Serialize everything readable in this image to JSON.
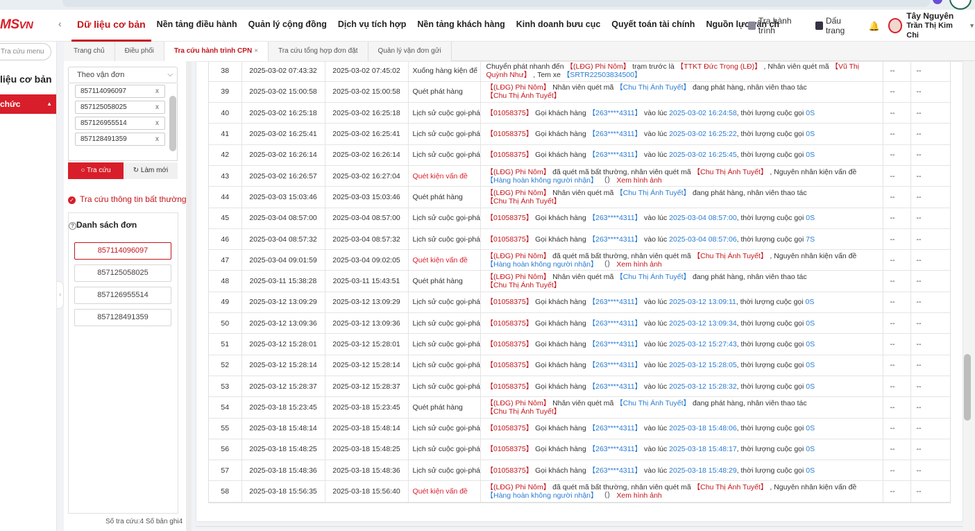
{
  "logo": {
    "main": "MS",
    "suffix": "VN"
  },
  "header": {
    "nav": [
      "Dữ liệu cơ bản",
      "Nền tảng điều hành",
      "Quản lý cộng đồng",
      "Dịch vụ tích hợp",
      "Nền tảng khách hàng",
      "Kinh doanh bưu cục",
      "Quyết toán tài chính",
      "Nguồn lực vận ch"
    ],
    "track_label": "Tra hành trình",
    "bookmark_label": "Dấu trang",
    "user_region": "Tây Nguyên",
    "user_name": "Trần Thị Kim Chi"
  },
  "leftnav": {
    "search_placeholder": "Tra cứu menu",
    "title": "liệu cơ bản",
    "active_item": "chức"
  },
  "tabs": [
    "Trang chủ",
    "Điều phối",
    "Tra cứu hành trình CPN",
    "Tra cứu tổng hợp đơn đặt",
    "Quản lý vận đơn gửi"
  ],
  "active_tab_close": "×",
  "search": {
    "select_value": "Theo vận đơn",
    "tags": [
      "857114096097",
      "857125058025",
      "857126955514",
      "857128491359"
    ],
    "search_btn": "Tra cứu",
    "reset_btn": "Làm mới",
    "abnormal_label": "Tra cứu thông tin bất thường",
    "list_title": "Danh sách đơn",
    "orders": [
      "857114096097",
      "857125058025",
      "857126955514",
      "857128491359"
    ],
    "footer": "Số tra cứu:4  Số bản ghi4"
  },
  "rows": [
    {
      "no": "38",
      "t1": "2025-03-02 07:43:32",
      "t2": "2025-03-02 07:45:02",
      "act": "Xuống hàng kiện đế",
      "warn": false,
      "desc": [
        [
          "n",
          "Chuyển phát nhanh đến "
        ],
        [
          "r",
          "【(LĐG) Phi Nôm】"
        ],
        [
          "n",
          " trạm trước là "
        ],
        [
          "r",
          "【TTKT Đức Trọng (LĐ)】"
        ],
        [
          "n",
          " , Nhân viên quét mã "
        ],
        [
          "r",
          "【Vũ Thị Quỳnh Như】"
        ],
        [
          "n",
          " ,  Tem xe "
        ],
        [
          "b",
          "【SRTR22503834500】"
        ]
      ]
    },
    {
      "no": "39",
      "t1": "2025-03-02 15:00:58",
      "t2": "2025-03-02 15:00:58",
      "act": "Quét phát hàng",
      "warn": false,
      "desc": [
        [
          "r",
          "【(LĐG) Phi Nôm】"
        ],
        [
          "n",
          " Nhân viên quét mã "
        ],
        [
          "b",
          "【Chu Thị Ánh Tuyết】"
        ],
        [
          "n",
          " đang phát hàng, nhân viên thao tác "
        ],
        [
          "r",
          "【Chu Thị Ánh Tuyết】"
        ]
      ]
    },
    {
      "no": "40",
      "t1": "2025-03-02 16:25:18",
      "t2": "2025-03-02 16:25:18",
      "act": "Lịch sử cuộc gọi-phá",
      "warn": false,
      "desc": [
        [
          "r",
          "【01058375】"
        ],
        [
          "n",
          " Gọi khách hàng "
        ],
        [
          "b",
          "【263****4311】"
        ],
        [
          "n",
          " vào lúc "
        ],
        [
          "b",
          "2025-03-02 16:24:58"
        ],
        [
          "n",
          ", thời lượng cuộc gọi "
        ],
        [
          "b",
          "0S"
        ]
      ]
    },
    {
      "no": "41",
      "t1": "2025-03-02 16:25:41",
      "t2": "2025-03-02 16:25:41",
      "act": "Lịch sử cuộc gọi-phá",
      "warn": false,
      "desc": [
        [
          "r",
          "【01058375】"
        ],
        [
          "n",
          " Gọi khách hàng "
        ],
        [
          "b",
          "【263****4311】"
        ],
        [
          "n",
          " vào lúc "
        ],
        [
          "b",
          "2025-03-02 16:25:22"
        ],
        [
          "n",
          ", thời lượng cuộc gọi "
        ],
        [
          "b",
          "0S"
        ]
      ]
    },
    {
      "no": "42",
      "t1": "2025-03-02 16:26:14",
      "t2": "2025-03-02 16:26:14",
      "act": "Lịch sử cuộc gọi-phá",
      "warn": false,
      "desc": [
        [
          "r",
          "【01058375】"
        ],
        [
          "n",
          " Gọi khách hàng "
        ],
        [
          "b",
          "【263****4311】"
        ],
        [
          "n",
          " vào lúc "
        ],
        [
          "b",
          "2025-03-02 16:25:45"
        ],
        [
          "n",
          ", thời lượng cuộc gọi "
        ],
        [
          "b",
          "0S"
        ]
      ]
    },
    {
      "no": "43",
      "t1": "2025-03-02 16:26:57",
      "t2": "2025-03-02 16:27:04",
      "act": "Quét kiện vấn đề",
      "warn": true,
      "desc": [
        [
          "r",
          "【(LĐG) Phi Nôm】"
        ],
        [
          "n",
          " đã quét mã bất thường, nhân viên quét mã "
        ],
        [
          "r",
          "【Chu Thị Ánh Tuyết】"
        ],
        [
          "n",
          " ,  Nguyên nhân kiện vấn đề "
        ],
        [
          "b",
          "【Hàng hoàn không người nhận】"
        ],
        [
          "n",
          " （） "
        ],
        [
          "r",
          "Xem hình ảnh"
        ]
      ]
    },
    {
      "no": "44",
      "t1": "2025-03-03 15:03:46",
      "t2": "2025-03-03 15:03:46",
      "act": "Quét phát hàng",
      "warn": false,
      "desc": [
        [
          "r",
          "【(LĐG) Phi Nôm】"
        ],
        [
          "n",
          " Nhân viên quét mã "
        ],
        [
          "b",
          "【Chu Thị Ánh Tuyết】"
        ],
        [
          "n",
          " đang phát hàng, nhân viên thao tác "
        ],
        [
          "r",
          "【Chu Thị Ánh Tuyết】"
        ]
      ]
    },
    {
      "no": "45",
      "t1": "2025-03-04 08:57:00",
      "t2": "2025-03-04 08:57:00",
      "act": "Lịch sử cuộc gọi-phá",
      "warn": false,
      "desc": [
        [
          "r",
          "【01058375】"
        ],
        [
          "n",
          " Gọi khách hàng "
        ],
        [
          "b",
          "【263****4311】"
        ],
        [
          "n",
          " vào lúc "
        ],
        [
          "b",
          "2025-03-04 08:57:00"
        ],
        [
          "n",
          ", thời lượng cuộc gọi "
        ],
        [
          "b",
          "0S"
        ]
      ]
    },
    {
      "no": "46",
      "t1": "2025-03-04 08:57:32",
      "t2": "2025-03-04 08:57:32",
      "act": "Lịch sử cuộc gọi-phá",
      "warn": false,
      "desc": [
        [
          "r",
          "【01058375】"
        ],
        [
          "n",
          " Gọi khách hàng "
        ],
        [
          "b",
          "【263****4311】"
        ],
        [
          "n",
          " vào lúc "
        ],
        [
          "b",
          "2025-03-04 08:57:06"
        ],
        [
          "n",
          ", thời lượng cuộc gọi "
        ],
        [
          "b",
          "7S"
        ]
      ]
    },
    {
      "no": "47",
      "t1": "2025-03-04 09:01:59",
      "t2": "2025-03-04 09:02:05",
      "act": "Quét kiện vấn đề",
      "warn": true,
      "desc": [
        [
          "r",
          "【(LĐG) Phi Nôm】"
        ],
        [
          "n",
          " đã quét mã bất thường, nhân viên quét mã "
        ],
        [
          "r",
          "【Chu Thị Ánh Tuyết】"
        ],
        [
          "n",
          " ,  Nguyên nhân kiện vấn đề "
        ],
        [
          "b",
          "【Hàng hoàn không người nhận】"
        ],
        [
          "n",
          " （） "
        ],
        [
          "r",
          "Xem hình ảnh"
        ]
      ]
    },
    {
      "no": "48",
      "t1": "2025-03-11 15:38:28",
      "t2": "2025-03-11 15:43:51",
      "act": "Quét phát hàng",
      "warn": false,
      "desc": [
        [
          "r",
          "【(LĐG) Phi Nôm】"
        ],
        [
          "n",
          " Nhân viên quét mã "
        ],
        [
          "b",
          "【Chu Thị Ánh Tuyết】"
        ],
        [
          "n",
          " đang phát hàng, nhân viên thao tác "
        ],
        [
          "r",
          "【Chu Thị Ánh Tuyết】"
        ]
      ]
    },
    {
      "no": "49",
      "t1": "2025-03-12 13:09:29",
      "t2": "2025-03-12 13:09:29",
      "act": "Lịch sử cuộc gọi-phá",
      "warn": false,
      "desc": [
        [
          "r",
          "【01058375】"
        ],
        [
          "n",
          " Gọi khách hàng "
        ],
        [
          "b",
          "【263****4311】"
        ],
        [
          "n",
          " vào lúc "
        ],
        [
          "b",
          "2025-03-12 13:09:11"
        ],
        [
          "n",
          ", thời lượng cuộc gọi "
        ],
        [
          "b",
          "0S"
        ]
      ]
    },
    {
      "no": "50",
      "t1": "2025-03-12 13:09:36",
      "t2": "2025-03-12 13:09:36",
      "act": "Lịch sử cuộc gọi-phá",
      "warn": false,
      "desc": [
        [
          "r",
          "【01058375】"
        ],
        [
          "n",
          " Gọi khách hàng "
        ],
        [
          "b",
          "【263****4311】"
        ],
        [
          "n",
          " vào lúc "
        ],
        [
          "b",
          "2025-03-12 13:09:34"
        ],
        [
          "n",
          ", thời lượng cuộc gọi "
        ],
        [
          "b",
          "0S"
        ]
      ]
    },
    {
      "no": "51",
      "t1": "2025-03-12 15:28:01",
      "t2": "2025-03-12 15:28:01",
      "act": "Lịch sử cuộc gọi-phá",
      "warn": false,
      "desc": [
        [
          "r",
          "【01058375】"
        ],
        [
          "n",
          " Gọi khách hàng "
        ],
        [
          "b",
          "【263****4311】"
        ],
        [
          "n",
          " vào lúc "
        ],
        [
          "b",
          "2025-03-12 15:27:43"
        ],
        [
          "n",
          ", thời lượng cuộc gọi "
        ],
        [
          "b",
          "0S"
        ]
      ]
    },
    {
      "no": "52",
      "t1": "2025-03-12 15:28:14",
      "t2": "2025-03-12 15:28:14",
      "act": "Lịch sử cuộc gọi-phá",
      "warn": false,
      "desc": [
        [
          "r",
          "【01058375】"
        ],
        [
          "n",
          " Gọi khách hàng "
        ],
        [
          "b",
          "【263****4311】"
        ],
        [
          "n",
          " vào lúc "
        ],
        [
          "b",
          "2025-03-12 15:28:05"
        ],
        [
          "n",
          ", thời lượng cuộc gọi "
        ],
        [
          "b",
          "0S"
        ]
      ]
    },
    {
      "no": "53",
      "t1": "2025-03-12 15:28:37",
      "t2": "2025-03-12 15:28:37",
      "act": "Lịch sử cuộc gọi-phá",
      "warn": false,
      "desc": [
        [
          "r",
          "【01058375】"
        ],
        [
          "n",
          " Gọi khách hàng "
        ],
        [
          "b",
          "【263****4311】"
        ],
        [
          "n",
          " vào lúc "
        ],
        [
          "b",
          "2025-03-12 15:28:32"
        ],
        [
          "n",
          ", thời lượng cuộc gọi "
        ],
        [
          "b",
          "0S"
        ]
      ]
    },
    {
      "no": "54",
      "t1": "2025-03-18 15:23:45",
      "t2": "2025-03-18 15:23:45",
      "act": "Quét phát hàng",
      "warn": false,
      "desc": [
        [
          "r",
          "【(LĐG) Phi Nôm】"
        ],
        [
          "n",
          " Nhân viên quét mã "
        ],
        [
          "b",
          "【Chu Thị Ánh Tuyết】"
        ],
        [
          "n",
          " đang phát hàng, nhân viên thao tác "
        ],
        [
          "r",
          "【Chu Thị Ánh Tuyết】"
        ]
      ]
    },
    {
      "no": "55",
      "t1": "2025-03-18 15:48:14",
      "t2": "2025-03-18 15:48:14",
      "act": "Lịch sử cuộc gọi-phá",
      "warn": false,
      "desc": [
        [
          "r",
          "【01058375】"
        ],
        [
          "n",
          " Gọi khách hàng "
        ],
        [
          "b",
          "【263****4311】"
        ],
        [
          "n",
          " vào lúc "
        ],
        [
          "b",
          "2025-03-18 15:48:06"
        ],
        [
          "n",
          ", thời lượng cuộc gọi "
        ],
        [
          "b",
          "0S"
        ]
      ]
    },
    {
      "no": "56",
      "t1": "2025-03-18 15:48:25",
      "t2": "2025-03-18 15:48:25",
      "act": "Lịch sử cuộc gọi-phá",
      "warn": false,
      "desc": [
        [
          "r",
          "【01058375】"
        ],
        [
          "n",
          " Gọi khách hàng "
        ],
        [
          "b",
          "【263****4311】"
        ],
        [
          "n",
          " vào lúc "
        ],
        [
          "b",
          "2025-03-18 15:48:17"
        ],
        [
          "n",
          ", thời lượng cuộc gọi "
        ],
        [
          "b",
          "0S"
        ]
      ]
    },
    {
      "no": "57",
      "t1": "2025-03-18 15:48:36",
      "t2": "2025-03-18 15:48:36",
      "act": "Lịch sử cuộc gọi-phá",
      "warn": false,
      "desc": [
        [
          "r",
          "【01058375】"
        ],
        [
          "n",
          " Gọi khách hàng "
        ],
        [
          "b",
          "【263****4311】"
        ],
        [
          "n",
          " vào lúc "
        ],
        [
          "b",
          "2025-03-18 15:48:29"
        ],
        [
          "n",
          ", thời lượng cuộc gọi "
        ],
        [
          "b",
          "0S"
        ]
      ]
    },
    {
      "no": "58",
      "t1": "2025-03-18 15:56:35",
      "t2": "2025-03-18 15:56:40",
      "act": "Quét kiện vấn đề",
      "warn": true,
      "desc": [
        [
          "r",
          "【(LĐG) Phi Nôm】"
        ],
        [
          "n",
          " đã quét mã bất thường, nhân viên quét mã "
        ],
        [
          "r",
          "【Chu Thị Ánh Tuyết】"
        ],
        [
          "n",
          " ,  Nguyên nhân kiện vấn đề "
        ],
        [
          "b",
          "【Hàng hoàn không người nhận】"
        ],
        [
          "n",
          " （） "
        ],
        [
          "r",
          "Xem hình ảnh"
        ]
      ]
    }
  ],
  "empty_cell": "--",
  "colors": {
    "brand_red": "#d81e2a",
    "link_blue": "#2a7bd1",
    "text_red": "#c3161c"
  }
}
